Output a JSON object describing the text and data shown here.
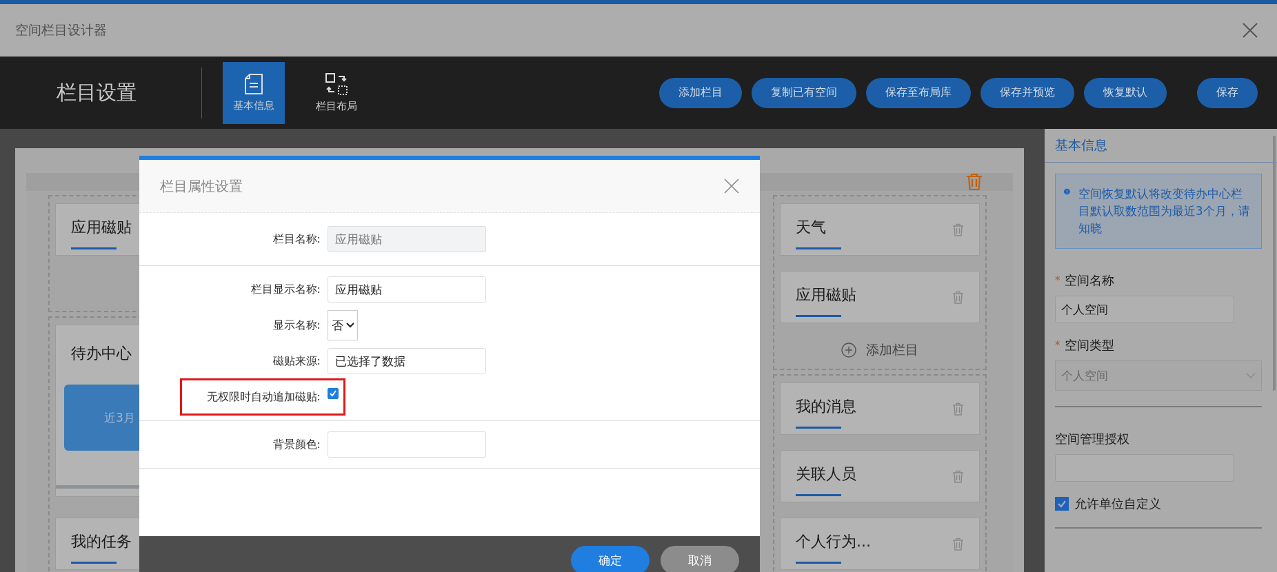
{
  "window": {
    "title": "空间栏目设计器"
  },
  "toolbar": {
    "title": "栏目设置",
    "tabs": [
      {
        "label": "基本信息",
        "selected": true
      },
      {
        "label": "栏目布局",
        "selected": false
      }
    ],
    "buttons": [
      "添加栏目",
      "复制已有空间",
      "保存至布局库",
      "保存并预览",
      "恢复默认",
      "保存"
    ]
  },
  "canvas": {
    "left_groups": [
      [
        {
          "kind": "card",
          "title": "应用磁贴"
        }
      ],
      [
        {
          "kind": "todo",
          "title": "待办中心",
          "bubble": "近3月"
        },
        {
          "kind": "card",
          "title": "我的任务"
        }
      ]
    ],
    "right_groups": [
      [
        {
          "kind": "card",
          "title": "天气"
        },
        {
          "kind": "card",
          "title": "应用磁贴"
        }
      ],
      [
        {
          "kind": "card",
          "title": "我的消息"
        },
        {
          "kind": "card",
          "title": "关联人员"
        },
        {
          "kind": "card",
          "title": "个人行为..."
        }
      ]
    ],
    "add_label": "添加栏目"
  },
  "dialog": {
    "title": "栏目属性设置",
    "sections": [
      [
        {
          "label": "栏目名称:",
          "kind": "text",
          "value": "应用磁贴",
          "disabled": true
        }
      ],
      [
        {
          "label": "栏目显示名称:",
          "kind": "text",
          "value": "应用磁贴",
          "disabled": false
        },
        {
          "label": "显示名称:",
          "kind": "select",
          "value": "否"
        },
        {
          "label": "磁贴来源:",
          "kind": "text",
          "value": "已选择了数据",
          "disabled": false
        },
        {
          "label": "无权限时自动追加磁贴:",
          "kind": "checkbox",
          "checked": true,
          "highlighted": true
        }
      ],
      [
        {
          "label": "背景颜色:",
          "kind": "text",
          "disabled": false
        }
      ]
    ],
    "buttons": [
      {
        "label": "确定",
        "primary": true
      },
      {
        "label": "取消",
        "primary": false
      }
    ]
  },
  "properties_panel": {
    "title": "基本信息",
    "notice": "空间恢复默认将改变待办中心栏目默认取数范围为最近3个月，请知晓",
    "sections": [
      [
        {
          "label": "空间名称",
          "marker": "*",
          "kind": "text",
          "value": "个人空间"
        },
        {
          "label": "空间类型",
          "marker": "*",
          "kind": "select",
          "value": "个人空间",
          "disabled": true
        }
      ],
      [
        {
          "label": "空间管理授权",
          "kind": "text"
        },
        {
          "label": "允许单位自定义",
          "kind": "checkbox",
          "checked": true
        }
      ]
    ]
  }
}
